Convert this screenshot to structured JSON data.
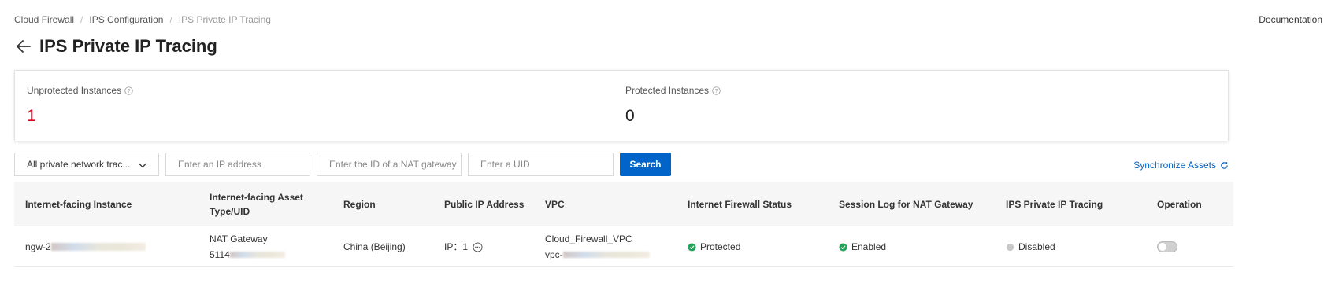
{
  "breadcrumb": {
    "items": [
      "Cloud Firewall",
      "IPS Configuration",
      "IPS Private IP Tracing"
    ],
    "separator": "/"
  },
  "documentation_label": "Documentation",
  "page_title": "IPS Private IP Tracing",
  "stats": {
    "unprotected": {
      "label": "Unprotected Instances",
      "value": "1",
      "color": "#d9001b"
    },
    "protected": {
      "label": "Protected Instances",
      "value": "0"
    }
  },
  "filters": {
    "scope_select": "All private network trac...",
    "ip_placeholder": "Enter an IP address",
    "nat_placeholder": "Enter the ID of a NAT gateway",
    "uid_placeholder": "Enter a UID",
    "search_label": "Search",
    "sync_label": "Synchronize Assets"
  },
  "table": {
    "headers": {
      "instance": "Internet-facing Instance",
      "asset_type_line1": "Internet-facing Asset",
      "asset_type_line2": "Type/UID",
      "region": "Region",
      "public_ip": "Public IP Address",
      "vpc": "VPC",
      "fw_status": "Internet Firewall Status",
      "session_log": "Session Log for NAT Gateway",
      "ips_tracing": "IPS Private IP Tracing",
      "operation": "Operation"
    },
    "rows": [
      {
        "instance_prefix": "ngw-2",
        "asset_type": "NAT Gateway",
        "uid_prefix": "5114",
        "region": "China (Beijing)",
        "public_ip": "IP：1",
        "vpc_name": "Cloud_Firewall_VPC",
        "vpc_id_prefix": "vpc-",
        "fw_status": "Protected",
        "session_log": "Enabled",
        "ips_tracing": "Disabled",
        "toggle_on": false
      }
    ]
  },
  "colors": {
    "accent": "#0064c8",
    "success": "#23a35a",
    "disabled": "#c8c8c8",
    "danger": "#d9001b"
  }
}
